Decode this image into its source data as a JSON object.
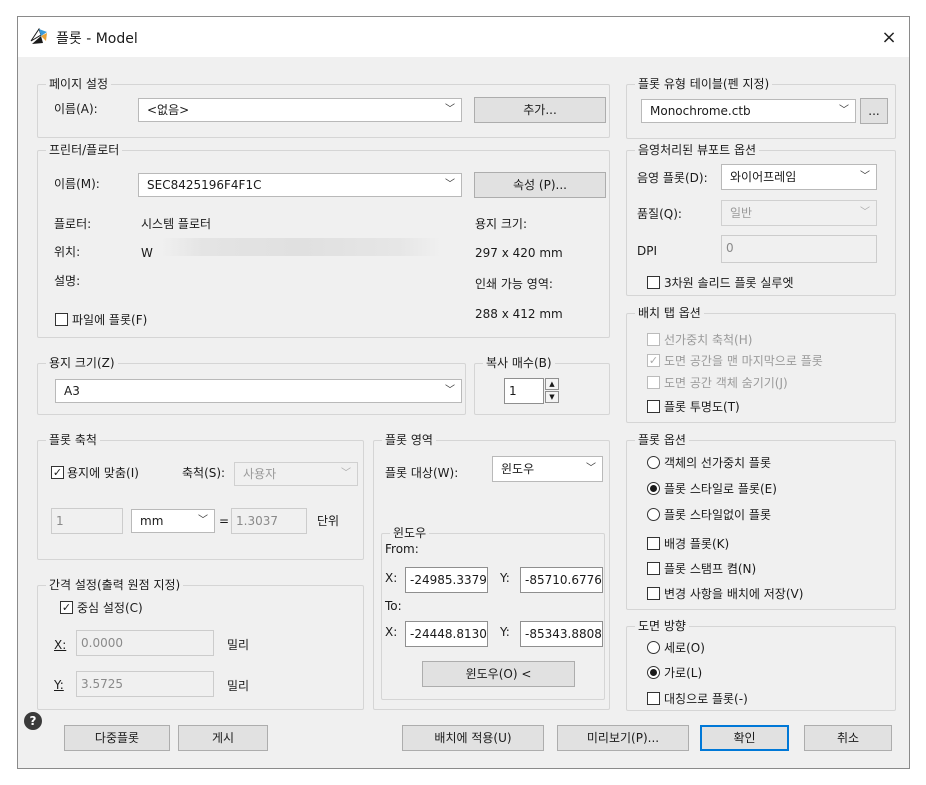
{
  "window": {
    "title": "플롯 - Model",
    "close_icon": "×"
  },
  "page_setup": {
    "title": "페이지 설정",
    "name_label": "이름(A):",
    "name_value": "<없음>",
    "add_button": "추가..."
  },
  "printer": {
    "title": "프린터/플로터",
    "name_label": "이름(M):",
    "name_value": "SEC8425196F4F1C",
    "properties_button": "속성 (P)...",
    "plotter_label": "플로터:",
    "plotter_value": "시스템 플로터",
    "location_label": "위치:",
    "location_value": "W",
    "description_label": "설명:",
    "paper_size_label": "용지 크기:",
    "paper_size_value": "297 x 420 mm",
    "printable_label": "인쇄 가능 영역:",
    "printable_value": "288 x 412 mm",
    "plot_to_file_label": "파일에 플롯(F)"
  },
  "paper_size": {
    "title": "용지 크기(Z)",
    "value": "A3"
  },
  "copies": {
    "title": "복사 매수(B)",
    "value": "1"
  },
  "plot_scale": {
    "title": "플롯 축척",
    "fit_label": "용지에 맞춤(I)",
    "scale_label": "축척(S):",
    "scale_value": "사용자",
    "num_value": "1",
    "unit_value": "mm",
    "equals": "=",
    "denom_value": "1.3037",
    "unit_label": "단위"
  },
  "plot_offset": {
    "title": "간격 설정(출력 원점 지정)",
    "center_label": "중심 설정(C)",
    "x_label": "X:",
    "x_value": "0.0000",
    "x_unit": "밀리",
    "y_label": "Y:",
    "y_value": "3.5725",
    "y_unit": "밀리"
  },
  "plot_area": {
    "title": "플롯 영역",
    "target_label": "플롯 대상(W):",
    "target_value": "윈도우",
    "window_group_title": "윈도우",
    "from_label": "From:",
    "from_x_label": "X:",
    "from_x_value": "-24985.3379",
    "from_y_label": "Y:",
    "from_y_value": "-85710.6776",
    "to_label": "To:",
    "to_x_label": "X:",
    "to_x_value": "-24448.8130",
    "to_y_label": "Y:",
    "to_y_value": "-85343.8808",
    "window_button": "윈도우(O) <"
  },
  "plot_style_table": {
    "title": "플롯 유형 테이블(펜 지정)",
    "value": "Monochrome.ctb",
    "edit_button": "..."
  },
  "shaded_viewport": {
    "title": "음영처리된 뷰포트 옵션",
    "shade_label": "음영 플롯(D):",
    "shade_value": "와이어프레임",
    "quality_label": "품질(Q):",
    "quality_value": "일반",
    "dpi_label": "DPI",
    "dpi_value": "0",
    "silhouette_label": "3차원 솔리드 플롯 실루엣"
  },
  "layout_tab": {
    "title": "배치 탭 옵션",
    "lineweight_scale_label": "선가중치 축척(H)",
    "paperspace_last_label": "도면 공간을 맨 마지막으로 플롯",
    "hide_objects_label": "도면 공간 객체 숨기기(J)",
    "transparency_label": "플롯 투명도(T)"
  },
  "plot_options": {
    "title": "플롯 옵션",
    "opt_lineweights": "객체의 선가중치 플롯",
    "opt_styles": "플롯 스타일로 플롯(E)",
    "opt_no_styles": "플롯 스타일없이 플롯",
    "background_label": "배경 플롯(K)",
    "stamp_label": "플롯 스탬프 켬(N)",
    "save_changes_label": "변경 사항을 배치에 저장(V)"
  },
  "orientation": {
    "title": "도면 방향",
    "portrait": "세로(O)",
    "landscape": "가로(L)",
    "upside_down": "대칭으로 플롯(-)"
  },
  "footer": {
    "help_icon": "?",
    "multiplot_button": "다중플롯",
    "publish_button": "게시",
    "apply_button": "배치에 적용(U)",
    "preview_button": "미리보기(P)...",
    "ok_button": "확인",
    "cancel_button": "취소"
  },
  "colors": {
    "accent": "#0078d7",
    "dialog_bg": "#f0f0f0"
  }
}
